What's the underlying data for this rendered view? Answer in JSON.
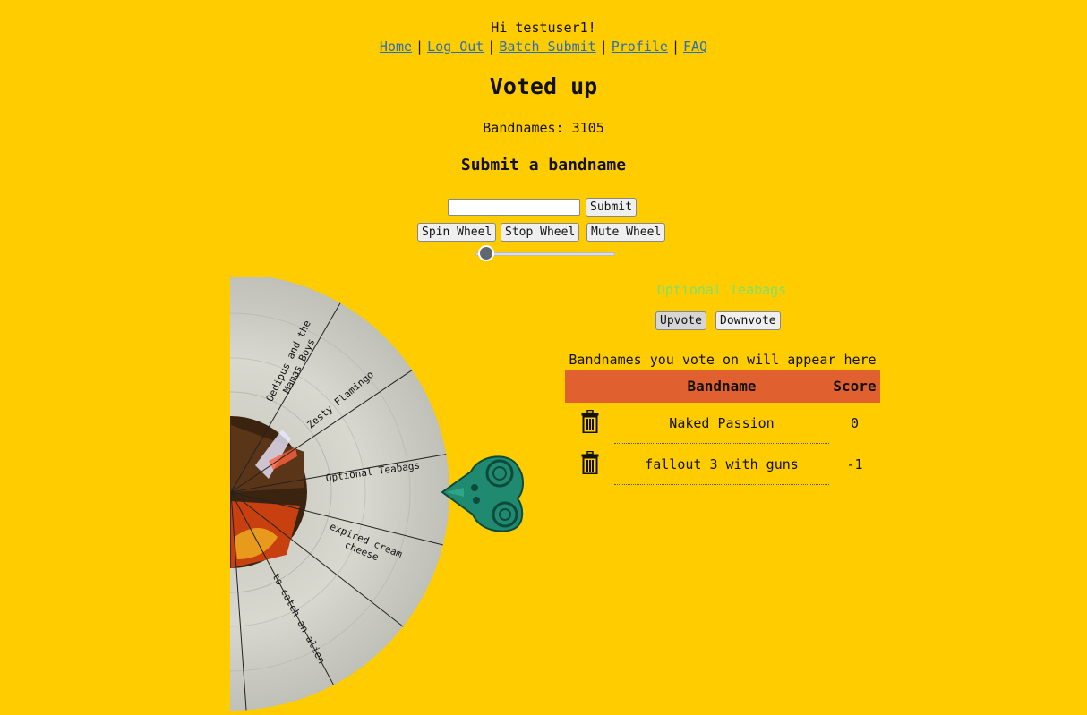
{
  "header": {
    "greeting": "Hi testuser1!",
    "nav": [
      {
        "label": "Home"
      },
      {
        "label": "Log Out"
      },
      {
        "label": "Batch Submit"
      },
      {
        "label": "Profile"
      },
      {
        "label": "FAQ"
      }
    ],
    "separator": "|"
  },
  "main": {
    "status_title": "Voted up",
    "count_text": "Bandnames: 3105",
    "submit_heading": "Submit a bandname",
    "input_value": "",
    "submit_label": "Submit"
  },
  "controls": {
    "spin_label": "Spin Wheel",
    "stop_label": "Stop Wheel",
    "mute_label": "Mute Wheel",
    "volume": 0.04
  },
  "wheel": {
    "segments": [
      "Oedipus and the Mamas Boys",
      "Zesty Flamingo",
      "Optional Teabags",
      "expired cream cheese",
      "to catch an alien"
    ]
  },
  "vote_panel": {
    "current_name": "Optional Teabags",
    "current_name_color": "#7fe06a",
    "upvote_label": "Upvote",
    "downvote_label": "Downvote",
    "caption": "Bandnames you vote on will appear here",
    "table": {
      "headers": [
        "",
        "Bandname",
        "Score"
      ],
      "rows": [
        {
          "name": "Naked Passion",
          "score": "0",
          "icon": "trash-icon"
        },
        {
          "name": "fallout 3 with guns",
          "score": "-1",
          "icon": "trash-icon"
        }
      ]
    }
  },
  "colors": {
    "background": "#ffcc00",
    "table_header": "#e06030",
    "link": "#2a6fb3"
  }
}
